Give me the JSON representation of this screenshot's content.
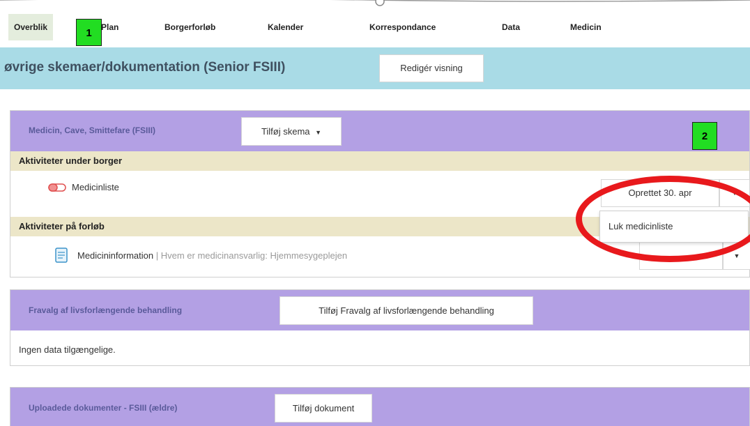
{
  "nav": {
    "items": [
      "Overblik",
      "Plan",
      "Borgerforløb",
      "Kalender",
      "Korrespondance",
      "Data",
      "Medicin"
    ],
    "markers": [
      "1",
      "2"
    ]
  },
  "header": {
    "title": "øvrige skemaer/dokumentation (Senior FSIII)",
    "edit_view_label": "Redigér visning"
  },
  "medicin_section": {
    "title": "Medicin, Cave, Smittefare (FSIII)",
    "add_form_label": "Tilføj skema",
    "group1_label": "Aktiviteter under borger",
    "row1_label": "Medicinliste",
    "row1_status": "Oprettet 30. apr",
    "menu_item": "Luk medicinliste",
    "group2_label": "Aktiviteter på forløb",
    "row2_label": "Medicininformation",
    "row2_sep": " | ",
    "row2_detail": "Hvem er medicinansvarlig: Hjemmesygeplejen"
  },
  "fravalg_section": {
    "title": "Fravalg af livsforlængende behandling",
    "add_label": "Tilføj Fravalg af livsforlængende behandling",
    "empty_text": "Ingen data tilgængelige."
  },
  "upload_section": {
    "title": "Uploadede dokumenter - FSIII (ældre)",
    "add_label": "Tilføj dokument"
  },
  "colors": {
    "title_band": "#a9dbe6",
    "section_header": "#b3a0e4",
    "subheader": "#ece6c8",
    "marker": "#22dd22",
    "annotation": "#e8191c"
  }
}
